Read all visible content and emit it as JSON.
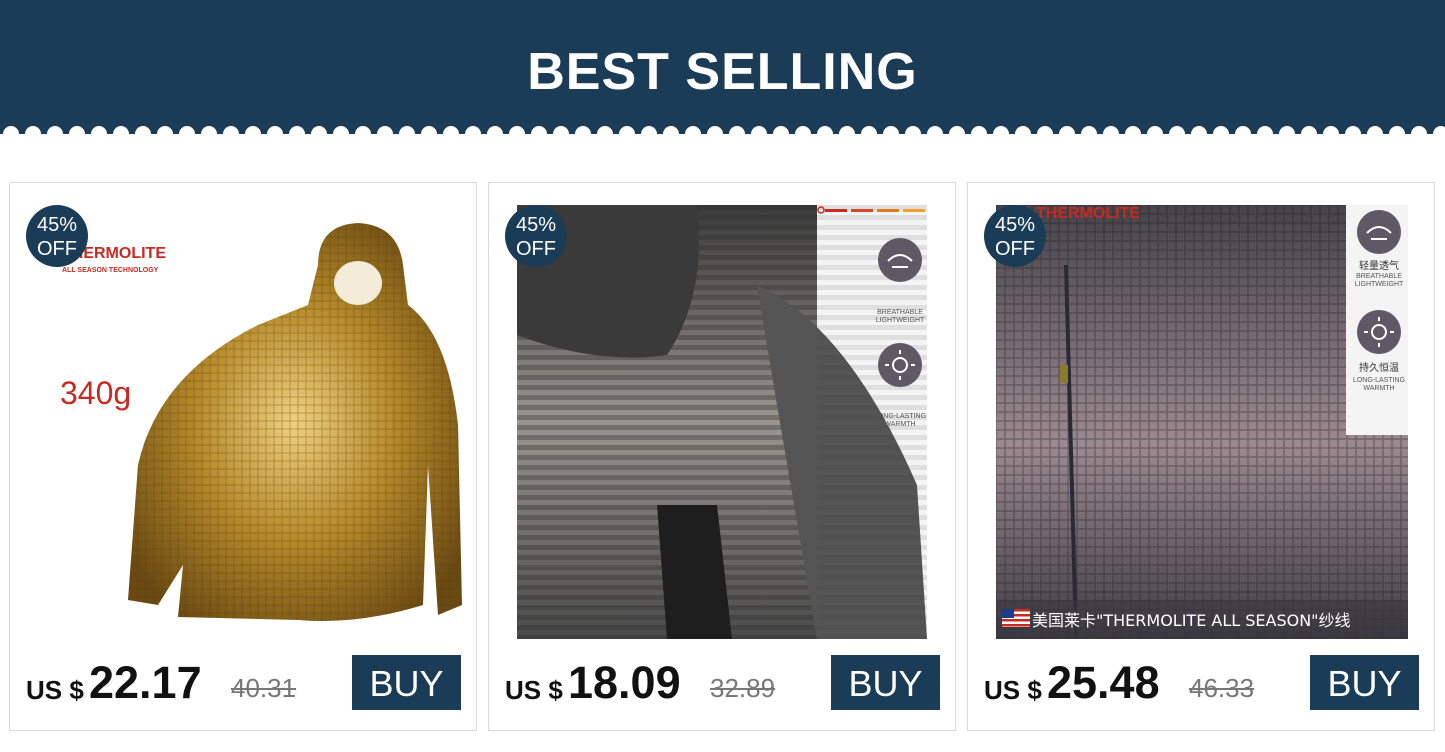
{
  "banner": {
    "title": "BEST SELLING",
    "color": "#1b3c56"
  },
  "products": [
    {
      "badge_pct": "45%",
      "badge_off": "OFF",
      "currency": "US $",
      "price": "22.17",
      "old_price": "40.31",
      "buy_label": "BUY",
      "brand_text": "THERMOLITE",
      "brand_sub": "ALL SEASON TECHNOLOGY",
      "weight_text": "340g"
    },
    {
      "badge_pct": "45%",
      "badge_off": "OFF",
      "currency": "US $",
      "price": "18.09",
      "old_price": "32.89",
      "buy_label": "BUY",
      "feature1": "BREATHABLE LIGHTWEIGHT",
      "feature2": "LONG-LASTING WARMTH"
    },
    {
      "badge_pct": "45%",
      "badge_off": "OFF",
      "currency": "US $",
      "price": "25.48",
      "old_price": "46.33",
      "buy_label": "BUY",
      "brand_text": "THERMOLITE",
      "feature1_cn": "轻量透气",
      "feature1": "BREATHABLE LIGHTWEIGHT",
      "feature2_cn": "持久恒温",
      "feature2": "LONG-LASTING WARMTH",
      "caption": "美国莱卡\"THERMOLITE ALL SEASON\"纱线"
    }
  ]
}
